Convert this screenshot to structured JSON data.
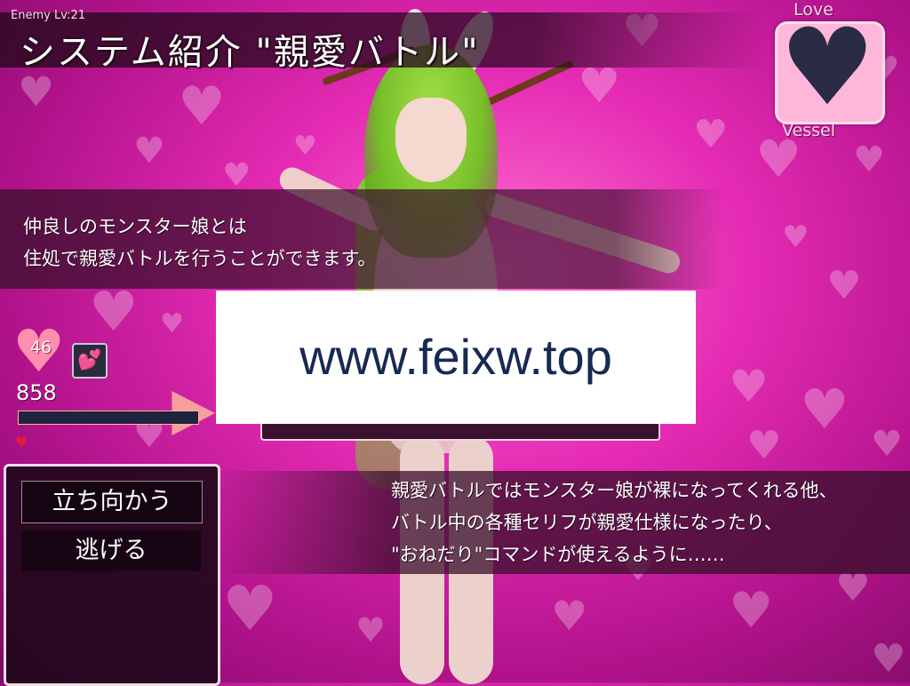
{
  "title": "システム紹介 \"親愛バトル\"",
  "enemy_level": "Enemy Lv:21",
  "love_vessel": {
    "label_top": "Love",
    "label_bottom": "Vessel",
    "heart_color": "#2a2b45"
  },
  "message_top": {
    "line1": "仲良しのモンスター娘とは",
    "line2": "住処で親愛バトルを行うことができます。"
  },
  "message_bottom": {
    "line1": "親愛バトルではモンスター娘が裸になってくれる他、",
    "line2": "バトル中の各種セリフが親愛仕様になったり、",
    "line3": "\"おねだり\"コマンドが使えるように……"
  },
  "watermark": "www.feixw.top",
  "status": {
    "heart_value": "46",
    "hp_value": "858",
    "skill_icon": "double-heart-icon"
  },
  "commands": [
    {
      "label": "立ち向かう",
      "selected": true
    },
    {
      "label": "逃げる",
      "selected": false
    }
  ],
  "colors": {
    "background": "#e52bb4",
    "window": "#3c0f2d",
    "heart_hp": "#ff8fae"
  }
}
